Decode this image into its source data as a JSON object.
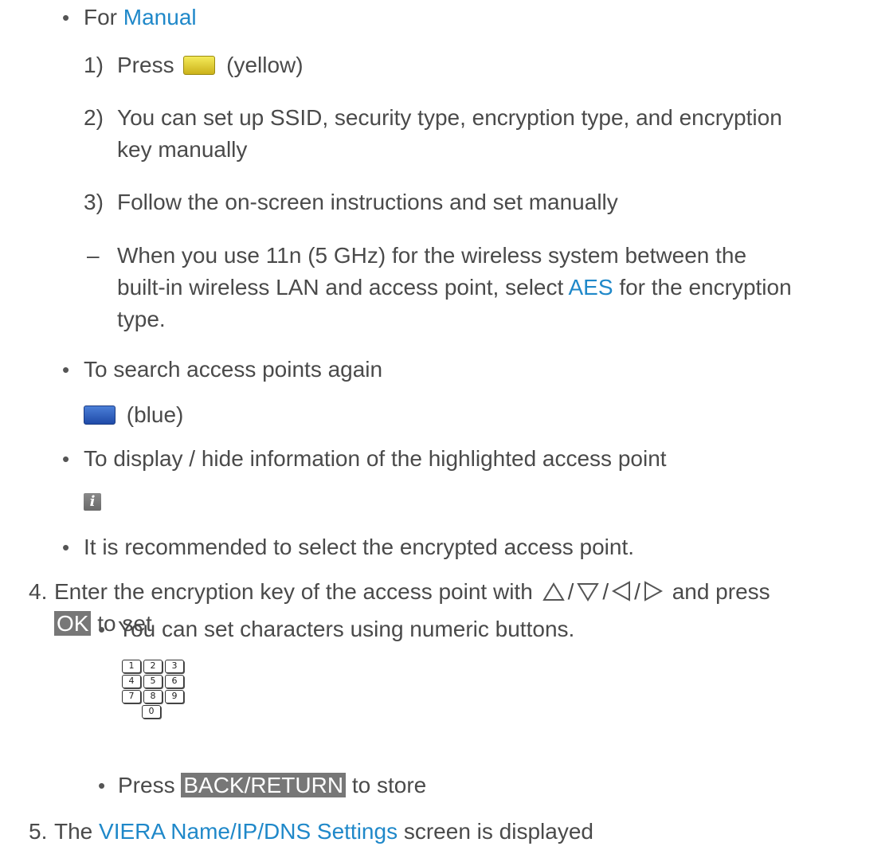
{
  "manual_section": {
    "for_label": "For",
    "manual_link": "Manual",
    "step1_num": "1)",
    "step1_text": "Press",
    "step1_suffix": "(yellow)",
    "step2_num": "2)",
    "step2_line1": "You can set up SSID, security type, encryption type, and encryption",
    "step2_line2": "key manually",
    "step3_num": "3)",
    "step3_text": "Follow the on-screen instructions and set manually",
    "note_dash": "–",
    "note_line1": "When you use 11n (5 GHz) for the wireless system between the",
    "note_line2a": "built-in wireless LAN and access point, select",
    "note_aes": "AES",
    "note_line2b": "for the encryption",
    "note_line3": "type."
  },
  "search_again": {
    "label": "To search access points again",
    "suffix": "(blue)"
  },
  "display_hide": {
    "label": "To display / hide information of the highlighted access point",
    "info_glyph": "i"
  },
  "recommend": {
    "text": "It is recommended to select the encrypted access point."
  },
  "step4": {
    "num": "4.",
    "text_a": "Enter the encryption key of the access point with",
    "sep": "/",
    "text_b": "and press",
    "ok": "OK",
    "text_c": "to set",
    "numeric_note": "You can set characters using numeric buttons.",
    "numpad_rows": [
      [
        "1",
        "2",
        "3"
      ],
      [
        "4",
        "5",
        "6"
      ],
      [
        "7",
        "8",
        "9"
      ]
    ],
    "numpad_zero": "0",
    "back_prefix": "Press",
    "back_key": "BACK/RETURN",
    "back_suffix": "to store"
  },
  "step5": {
    "num": "5.",
    "prefix": "The",
    "link": "VIERA Name/IP/DNS Settings",
    "suffix": "screen is displayed"
  },
  "colors": {
    "link": "#1f88c9",
    "text": "#4a4a4a",
    "key_bg": "#777777",
    "yellow_button": "#e6d83a",
    "blue_button": "#2f5fc2"
  }
}
